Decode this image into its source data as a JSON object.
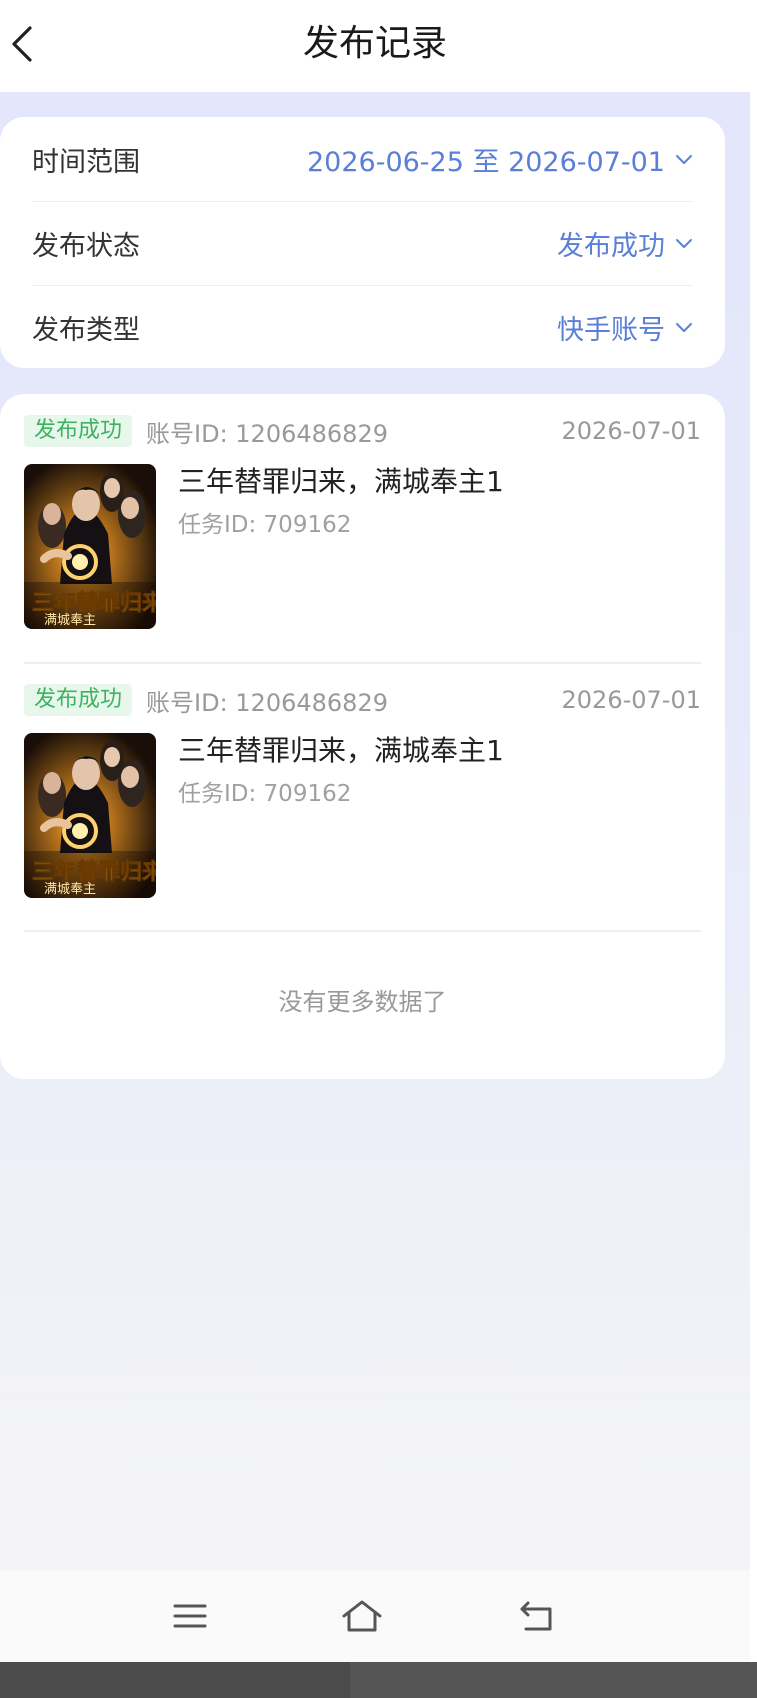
{
  "header": {
    "title": "发布记录",
    "back_icon": "chevron-left-icon"
  },
  "filters": {
    "time_range": {
      "label": "时间范围",
      "value": "2026-06-25 至 2026-07-01"
    },
    "status": {
      "label": "发布状态",
      "value": "发布成功"
    },
    "type": {
      "label": "发布类型",
      "value": "快手账号"
    },
    "accent_color": "#5b7fd8"
  },
  "records": [
    {
      "status": "发布成功",
      "account": "账号ID: 1206486829",
      "date": "2026-07-01",
      "title": "三年替罪归来，满城奉主1",
      "task": "任务ID: 709162",
      "poster_text": "三年替罪归来 满城奉主"
    },
    {
      "status": "发布成功",
      "account": "账号ID: 1206486829",
      "date": "2026-07-01",
      "title": "三年替罪归来，满城奉主1",
      "task": "任务ID: 709162",
      "poster_text": "三年替罪归来 满城奉主"
    }
  ],
  "list_footer": "没有更多数据了",
  "navbar": {
    "menu_icon": "menu-icon",
    "home_icon": "home-icon",
    "back_icon": "return-icon"
  },
  "colors": {
    "badge_bg": "#e7f7ec",
    "badge_text": "#3db361"
  }
}
